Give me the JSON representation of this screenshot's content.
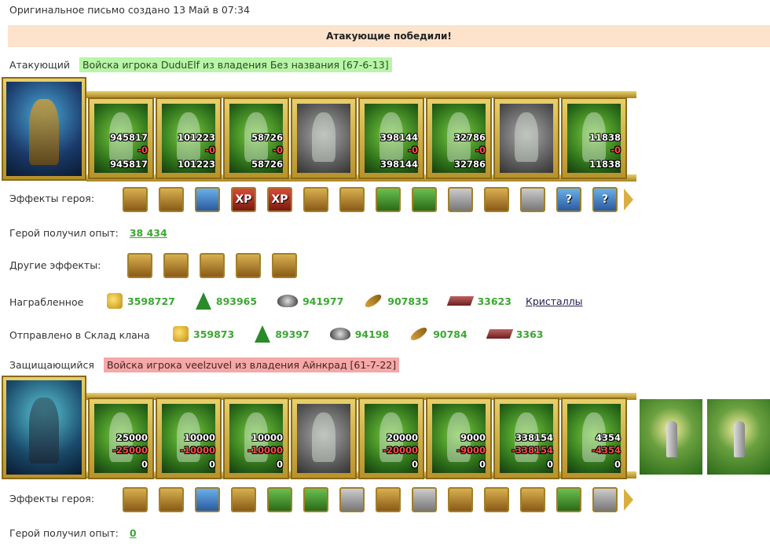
{
  "header": {
    "created": "Оригинальное письмо создано 13 Май в 07:34"
  },
  "banner": {
    "result": "Атакующие победили!"
  },
  "attacker": {
    "label": "Атакующий",
    "army": "Войска игрока DuduElf из владения Без названия [67-6-13]",
    "units": [
      {
        "a": "945817",
        "b": "-0",
        "c": "945817",
        "gray": false
      },
      {
        "a": "101223",
        "b": "-0",
        "c": "101223",
        "gray": false
      },
      {
        "a": "58726",
        "b": "-0",
        "c": "58726",
        "gray": false
      },
      {
        "a": "",
        "b": "",
        "c": "",
        "gray": true
      },
      {
        "a": "398144",
        "b": "-0",
        "c": "398144",
        "gray": false
      },
      {
        "a": "32786",
        "b": "-0",
        "c": "32786",
        "gray": false
      },
      {
        "a": "",
        "b": "",
        "c": "",
        "gray": true
      },
      {
        "a": "11838",
        "b": "-0",
        "c": "11838",
        "gray": false
      }
    ],
    "effects_label": "Эффекты героя:",
    "effects": [
      "sword-icon",
      "handshake-sword-icon",
      "hand-magic-icon",
      "XP",
      "XPXP",
      "fortress-icon",
      "dice-icon",
      "shield-icon",
      "handshake-shield-icon",
      "helmet-icon",
      "cross-icon",
      "armor-icon",
      "?",
      "?"
    ],
    "exp_label": "Герой получил опыт:",
    "exp_value": "38 434",
    "other_label": "Другие эффекты:",
    "other_effects": [
      "sword-icon",
      "handshake-sword-icon",
      "handshake-sword-icon",
      "handshake-sword-icon",
      "handshake-sword-icon"
    ],
    "loot_label": "Награбленное",
    "loot": {
      "gold": "3598727",
      "wood": "893965",
      "ore": "941977",
      "wheat": "907835",
      "crystals": "33623",
      "crystals_link": "Кристаллы"
    },
    "clan_label": "Отправлено в Склад клана",
    "clan": {
      "gold": "359873",
      "wood": "89397",
      "ore": "94198",
      "wheat": "90784",
      "crystals": "3363"
    }
  },
  "defender": {
    "label": "Защищающийся",
    "army": "Войска игрока veelzuvel из владения Айнкрад [61-7-22]",
    "units": [
      {
        "a": "25000",
        "b": "-25000",
        "c": "0",
        "gray": false
      },
      {
        "a": "10000",
        "b": "-10000",
        "c": "0",
        "gray": false
      },
      {
        "a": "10000",
        "b": "-10000",
        "c": "0",
        "gray": false
      },
      {
        "a": "",
        "b": "",
        "c": "",
        "gray": true
      },
      {
        "a": "20000",
        "b": "-20000",
        "c": "0",
        "gray": false
      },
      {
        "a": "9000",
        "b": "-9000",
        "c": "0",
        "gray": false
      },
      {
        "a": "338154",
        "b": "-338154",
        "c": "0",
        "gray": false
      },
      {
        "a": "4354",
        "b": "-4354",
        "c": "0",
        "gray": false
      }
    ],
    "effects_label": "Эффекты героя:",
    "effects": [
      "sword-icon",
      "handshake-sword-icon",
      "hand-magic-icon",
      "dice-icon",
      "shield-icon",
      "handshake-shield-icon",
      "helmet-icon",
      "amulet-icon",
      "armor-icon",
      "ring-icon",
      "scroll-icon",
      "axe-icon",
      "crest-shield-icon",
      "knight-helm-icon"
    ],
    "exp_label": "Герой получил опыт:",
    "exp_value": "0"
  }
}
